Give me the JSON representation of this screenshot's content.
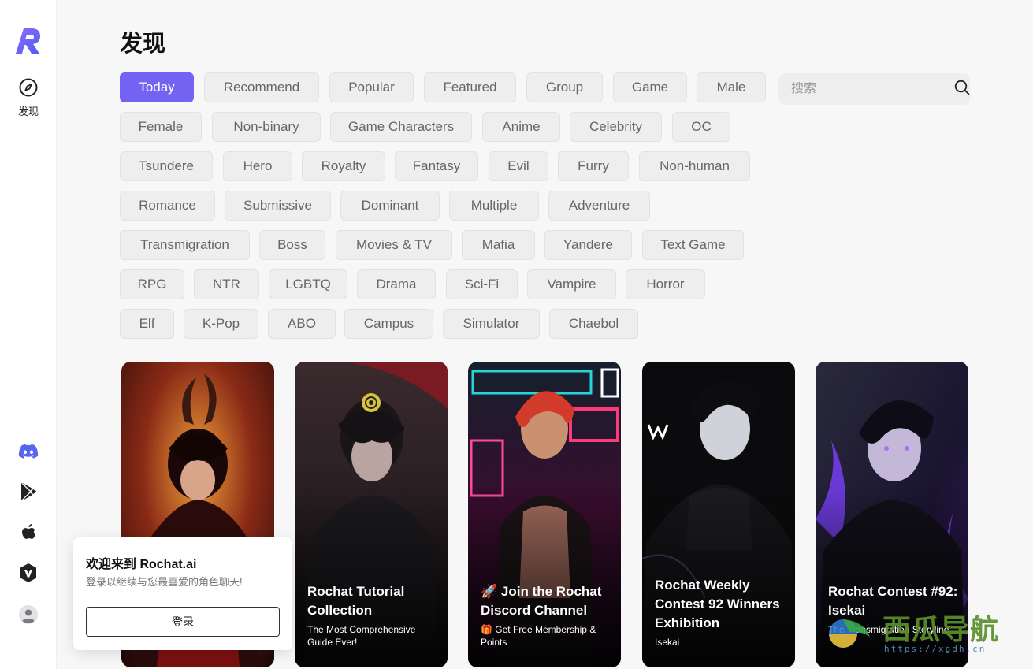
{
  "sidebar": {
    "discover_label": "发现"
  },
  "page": {
    "title": "发现"
  },
  "search": {
    "placeholder": "搜索"
  },
  "tags": [
    "Today",
    "Recommend",
    "Popular",
    "Featured",
    "Group",
    "Game",
    "Male",
    "Female",
    "Non-binary",
    "Game Characters",
    "Anime",
    "Celebrity",
    "OC",
    "Tsundere",
    "Hero",
    "Royalty",
    "Fantasy",
    "Evil",
    "Furry",
    "Non-human",
    "Romance",
    "Submissive",
    "Dominant",
    "Multiple",
    "Adventure",
    "Transmigration",
    "Boss",
    "Movies & TV",
    "Mafia",
    "Yandere",
    "Text Game",
    "RPG",
    "NTR",
    "LGBTQ",
    "Drama",
    "Sci-Fi",
    "Vampire",
    "Horror",
    "Elf",
    "K-Pop",
    "ABO",
    "Campus",
    "Simulator",
    "Chaebol"
  ],
  "cards": [
    {
      "title": "",
      "subtitle": ""
    },
    {
      "title": "Rochat Tutorial Collection",
      "subtitle": "The Most Comprehensive Guide Ever!"
    },
    {
      "title": "🚀 Join the Rochat Discord Channel",
      "subtitle": "🎁 Get Free Membership & Points"
    },
    {
      "title": "Rochat Weekly Contest 92 Winners Exhibition",
      "subtitle": "Isekai"
    },
    {
      "title": "Rochat Contest #92: Isekai",
      "subtitle": "The Transmigration Storyline"
    }
  ],
  "login_popup": {
    "title": "欢迎来到 Rochat.ai",
    "subtitle": "登录以继续与您最喜爱的角色聊天!",
    "button": "登录"
  },
  "watermark": {
    "text": "西瓜导航",
    "url": "https://xgdh.cn"
  },
  "colors": {
    "accent": "#7363f2",
    "discord": "#5865f2"
  }
}
